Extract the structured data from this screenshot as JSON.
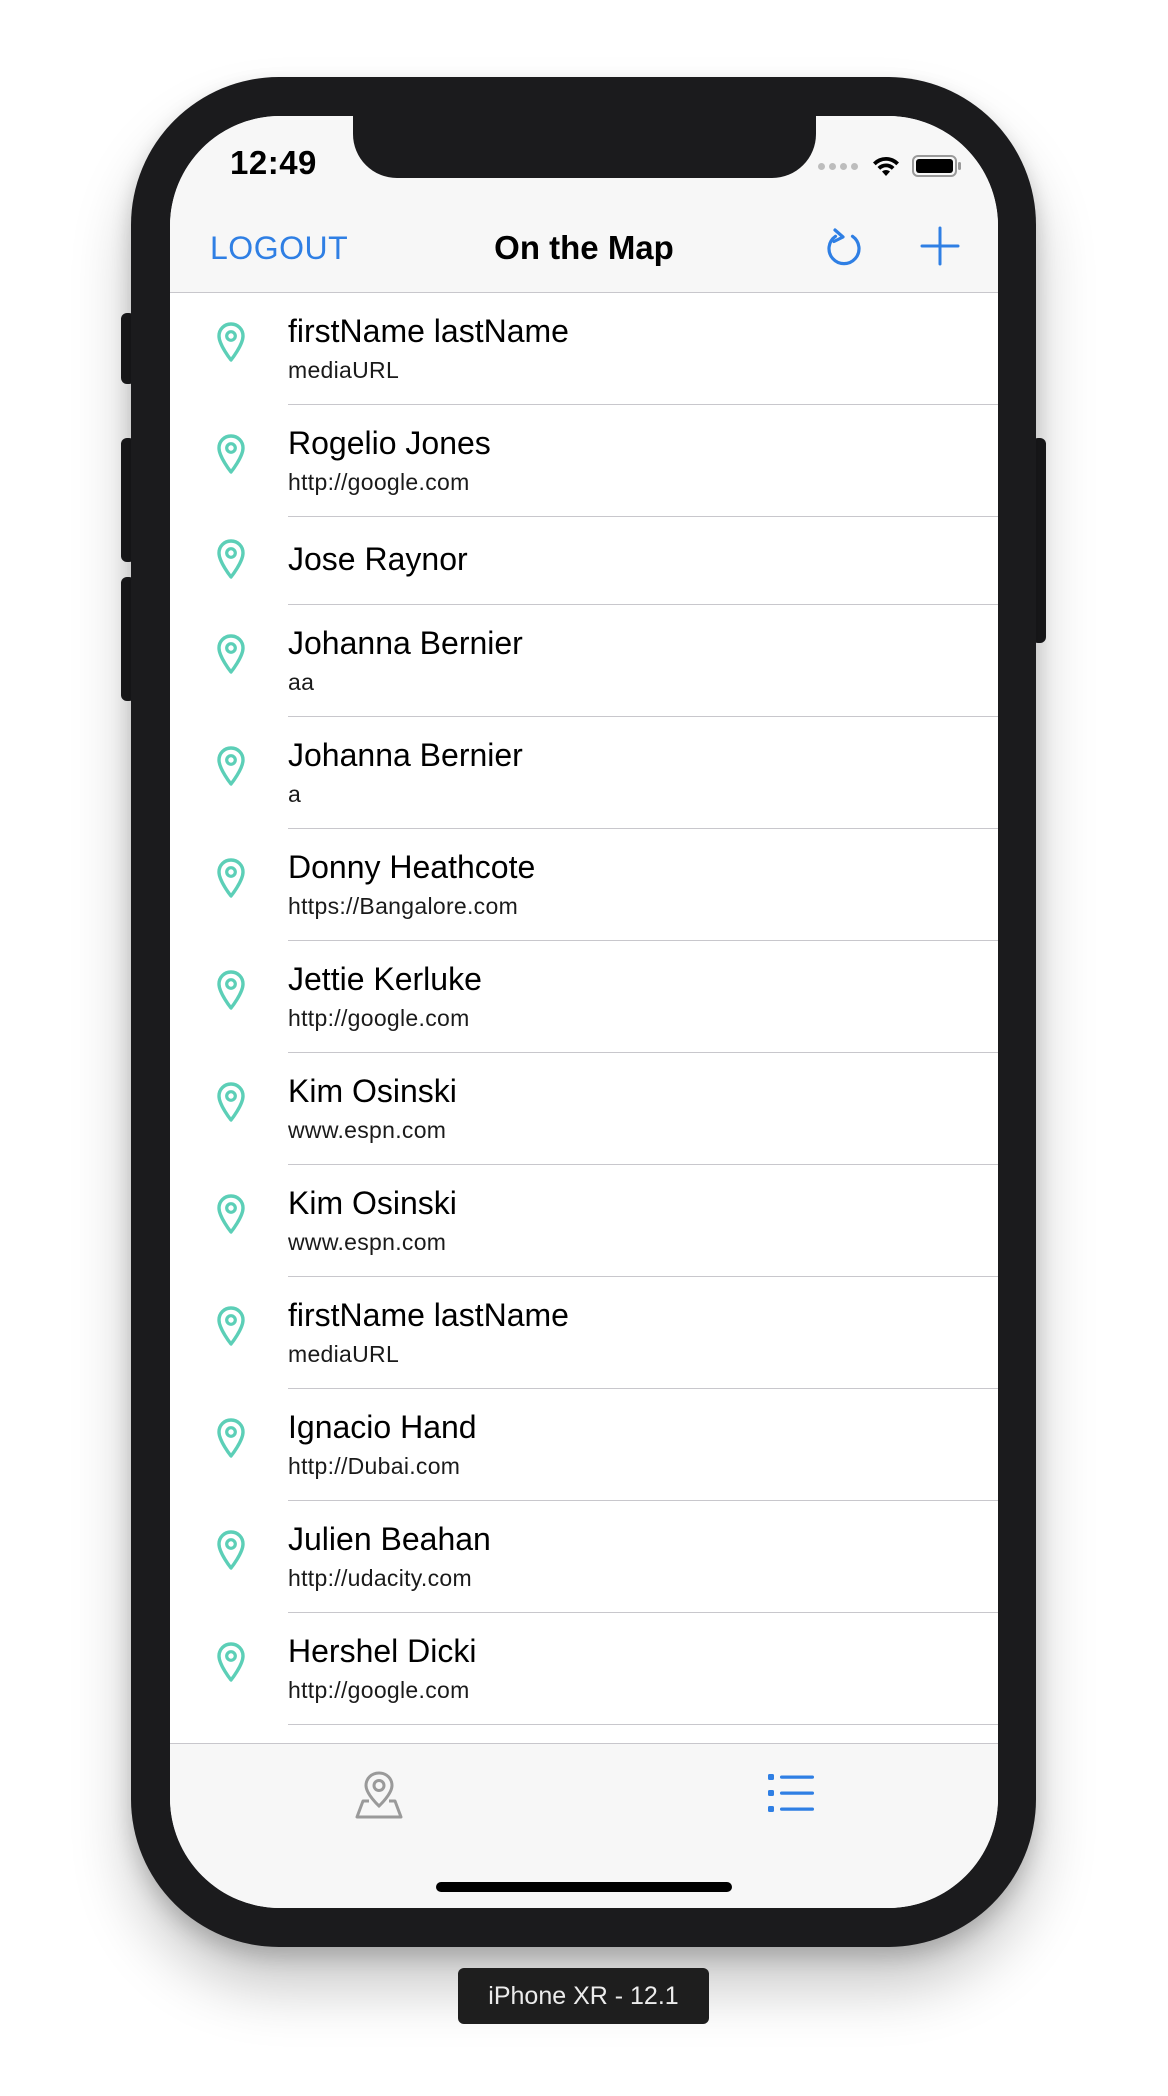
{
  "status_bar": {
    "time": "12:49"
  },
  "nav": {
    "left_button": "LOGOUT",
    "title": "On the Map",
    "refresh_icon": "refresh-icon",
    "add_icon": "plus-icon"
  },
  "colors": {
    "accent": "#2f7fe4",
    "pin": "#5ccfb7",
    "tab_inactive": "#9a9a9a"
  },
  "rows": [
    {
      "name": "firstName lastName",
      "url": "mediaURL"
    },
    {
      "name": "Rogelio Jones",
      "url": "http://google.com"
    },
    {
      "name": "Jose Raynor",
      "url": ""
    },
    {
      "name": "Johanna Bernier",
      "url": "aa"
    },
    {
      "name": "Johanna Bernier",
      "url": "a"
    },
    {
      "name": "Donny Heathcote",
      "url": "https://Bangalore.com"
    },
    {
      "name": "Jettie Kerluke",
      "url": "http://google.com"
    },
    {
      "name": "Kim Osinski",
      "url": "www.espn.com"
    },
    {
      "name": "Kim Osinski",
      "url": "www.espn.com"
    },
    {
      "name": "firstName lastName",
      "url": "mediaURL"
    },
    {
      "name": "Ignacio Hand",
      "url": "http://Dubai.com"
    },
    {
      "name": "Julien Beahan",
      "url": "http://udacity.com"
    },
    {
      "name": "Hershel Dicki",
      "url": "http://google.com"
    }
  ],
  "tab_bar": {
    "tabs": [
      {
        "icon": "map-pin-tab-icon",
        "selected": false
      },
      {
        "icon": "list-tab-icon",
        "selected": true
      }
    ]
  },
  "simulator_label": "iPhone XR - 12.1"
}
